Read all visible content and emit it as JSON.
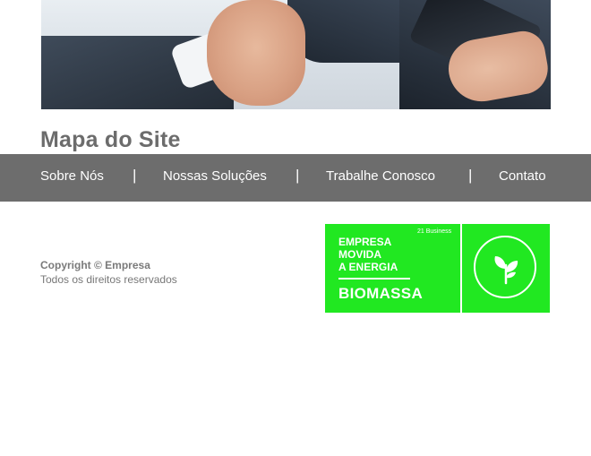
{
  "page": {
    "title": "Mapa do Site"
  },
  "hero": {
    "icon": "handshake-photo"
  },
  "nav": {
    "items": [
      {
        "label": "Sobre Nós"
      },
      {
        "label": "Nossas Soluções"
      },
      {
        "label": "Trabalhe Conosco"
      },
      {
        "label": "Contato"
      }
    ],
    "separator": "|"
  },
  "footer": {
    "copyright": "Copyright © Empresa",
    "rights": "Todos os direitos reservados"
  },
  "badge": {
    "line1": "EMPRESA",
    "line2": "MOVIDA",
    "line3": "A ENERGIA",
    "product": "BIOMASSA",
    "brand": "21 Business",
    "icon": "leaf-sprout-icon",
    "color": "#21e821"
  },
  "colors": {
    "nav_bg": "#6d6d6d",
    "title": "#6c6c6c"
  }
}
